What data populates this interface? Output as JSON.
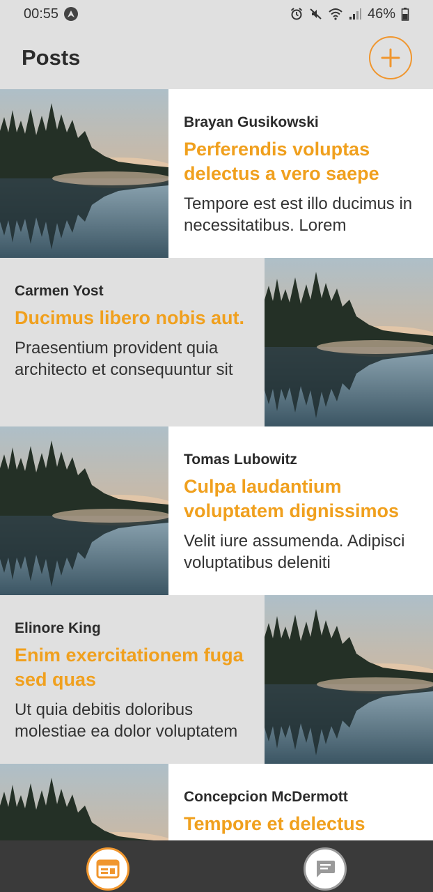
{
  "status": {
    "time": "00:55",
    "battery": "46%"
  },
  "header": {
    "title": "Posts"
  },
  "posts": [
    {
      "author": "Brayan Gusikowski",
      "title": "Perferendis voluptas delectus a vero saepe",
      "excerpt": "Tempore est est illo ducimus in necessitatibus. Lorem"
    },
    {
      "author": "Carmen Yost",
      "title": "Ducimus libero nobis aut.",
      "excerpt": "Praesentium provident quia architecto et consequuntur sit"
    },
    {
      "author": "Tomas Lubowitz",
      "title": "Culpa laudantium voluptatem dignissimos",
      "excerpt": "Velit iure assumenda. Adipisci voluptatibus deleniti"
    },
    {
      "author": "Elinore King",
      "title": "Enim exercitationem fuga sed quas",
      "excerpt": "Ut quia debitis doloribus molestiae ea dolor voluptatem"
    },
    {
      "author": "Concepcion McDermott",
      "title": "Tempore et delectus",
      "excerpt": ""
    }
  ],
  "colors": {
    "accent": "#f0962e",
    "title": "#f0a01e",
    "bar_bg": "#e0e0e0",
    "bottom_nav_bg": "#3a3a3a"
  },
  "icons": {
    "add": "plus-icon",
    "posts_tab": "feed-icon",
    "chat_tab": "chat-icon"
  }
}
